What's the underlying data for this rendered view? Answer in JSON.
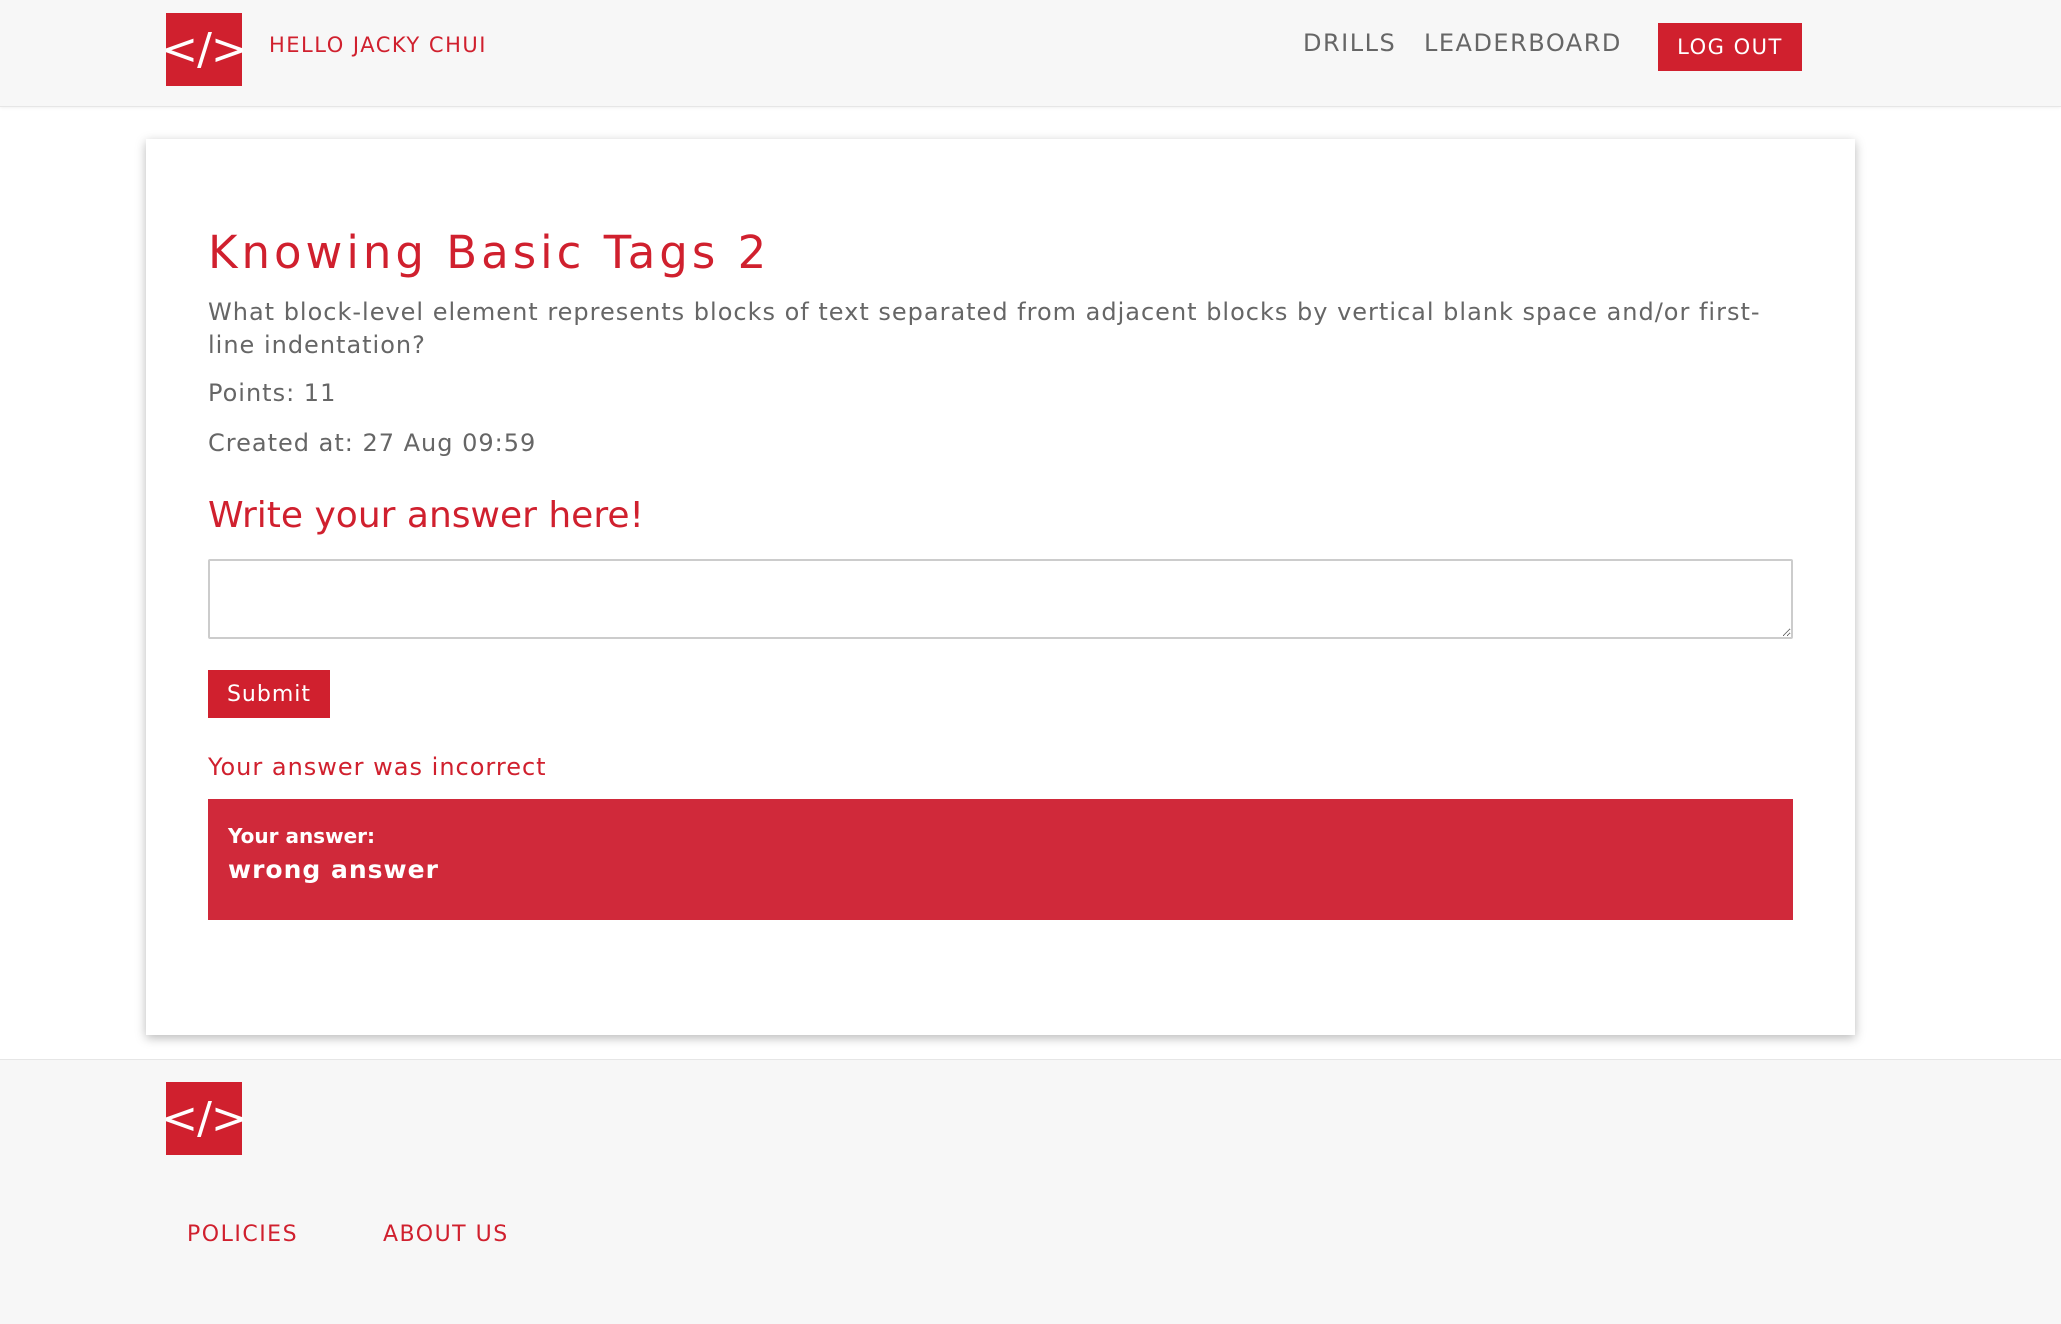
{
  "header": {
    "logo_icon": "code-brackets-icon",
    "logo_text": "</>",
    "greeting": "HELLO JACKY CHUI",
    "nav": {
      "drills": "DRILLS",
      "leaderboard": "LEADERBOARD",
      "logout": "LOG OUT"
    }
  },
  "drill": {
    "title": "Knowing Basic Tags 2",
    "question": "What block-level element represents blocks of text separated from adjacent blocks by vertical blank space and/or first-line indentation?",
    "points": "Points: 11",
    "created": "Created at: 27 Aug 09:59"
  },
  "answer_form": {
    "heading": "Write your answer here!",
    "input_value": "",
    "submit_label": "Submit"
  },
  "result": {
    "message": "Your answer was incorrect",
    "your_answer_label": "Your answer:",
    "your_answer_value": "wrong answer"
  },
  "footer": {
    "logo_icon": "code-brackets-icon",
    "logo_text": "</>",
    "policies": "POLICIES",
    "about": "ABOUT US"
  },
  "colors": {
    "accent": "#d0202e",
    "result_bg": "#d0293a",
    "text_muted": "#666666",
    "header_bg": "#f7f7f7"
  }
}
